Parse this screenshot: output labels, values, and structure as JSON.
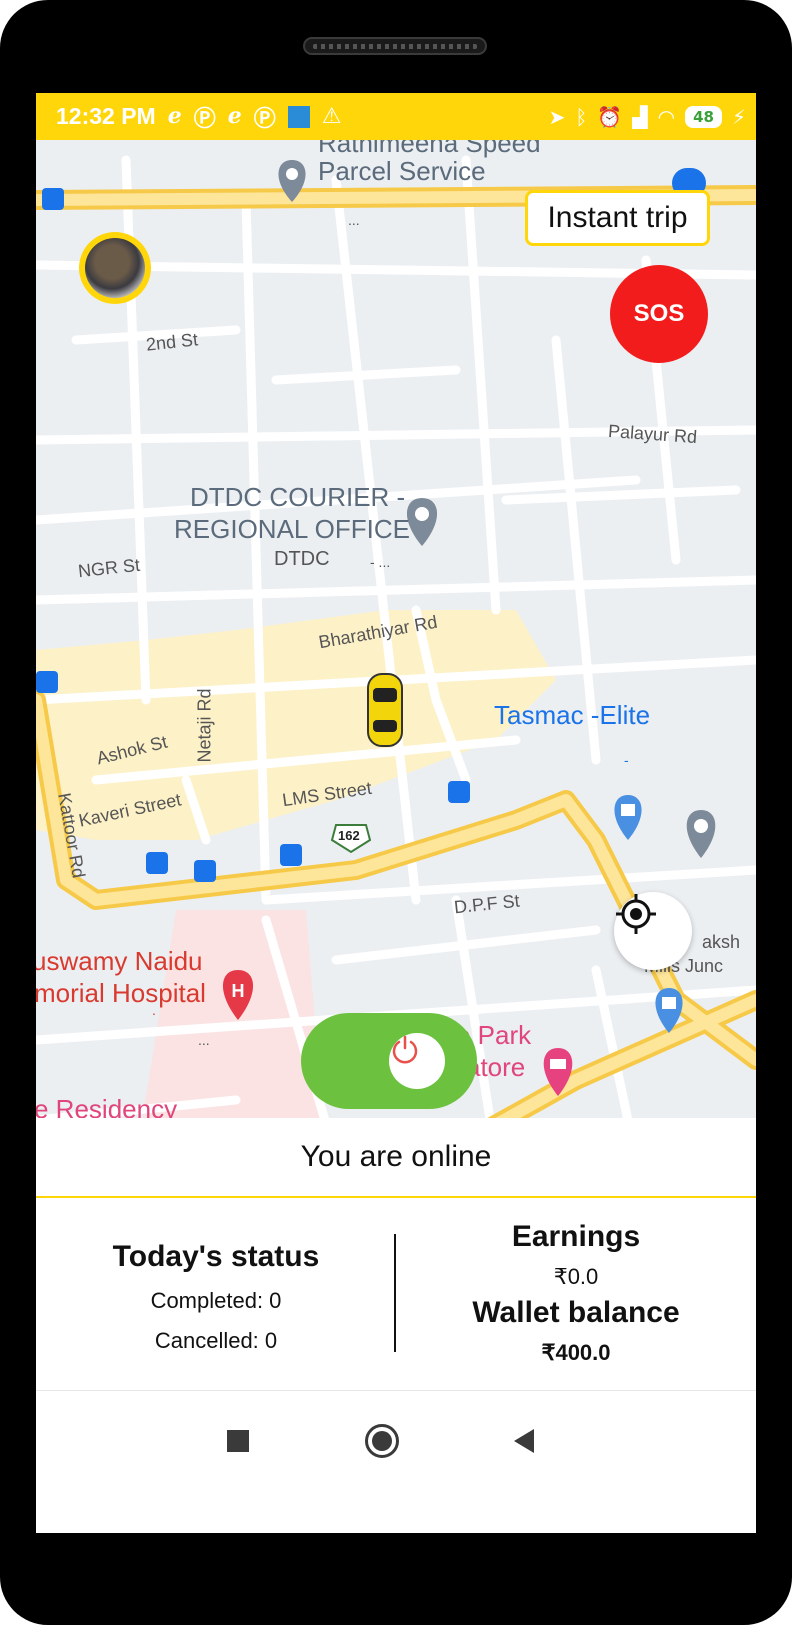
{
  "status_bar": {
    "time": "12:32 PM",
    "battery": "48",
    "icons_left": [
      "e-icon",
      "p-icon",
      "e-icon",
      "p-icon",
      "app-icon",
      "warning-icon"
    ],
    "icons_right": [
      "location-icon",
      "bluetooth-icon",
      "alarm-off-icon",
      "signal-icon",
      "wifi-icon",
      "battery-icon",
      "charging-icon"
    ]
  },
  "map": {
    "labels": {
      "parcel_top": "Rathimeena Speed",
      "parcel_bottom": "Parcel Service",
      "ellipsis_top": "...",
      "second_st": "2nd St",
      "palayur": "Palayur Rd",
      "dtdc_line1": "DTDC COURIER -",
      "dtdc_line2": "REGIONAL OFFICE",
      "dtdc_sub": "DTDC",
      "dtdc_dash": "- ...",
      "ngr": "NGR St",
      "bharathiyar": "Bharathiyar Rd",
      "netaji": "Netaji Rd",
      "ashok": "Ashok St",
      "tasmac": "Tasmac -Elite",
      "tasmac_dash": "-",
      "kattoor": "Kattoor Rd",
      "kaveri": "Kaveri Street",
      "lms": "LMS Street",
      "route": "162",
      "dpf": "D.P.F St",
      "hospital_line1": "uswamy Naidu",
      "hospital_line2": "morial Hospital",
      "hospital_dot": ".",
      "hospital_ellipsis": "...",
      "lakshmi_line1": "aksh",
      "lakshmi_line2": "Mills Junc",
      "park_line1": "e Park",
      "park_line2": "atore",
      "residency": "e Residency"
    },
    "colors": {
      "background": "#eceff2",
      "road": "#ffffff",
      "highway": "#fbd46b",
      "highlight_area": "#fdf1c8"
    }
  },
  "buttons": {
    "instant_trip": "Instant trip",
    "sos": "SOS"
  },
  "online_status": "You are online",
  "todays_status": {
    "title": "Today's status",
    "completed": "Completed: 0",
    "cancelled": "Cancelled: 0"
  },
  "earnings": {
    "title": "Earnings",
    "value": "₹0.0",
    "wallet_title": "Wallet balance",
    "wallet_value": "₹400.0"
  },
  "colors": {
    "accent": "#ffd60a",
    "sos": "#f21c1c",
    "online_toggle": "#6cc23f"
  }
}
